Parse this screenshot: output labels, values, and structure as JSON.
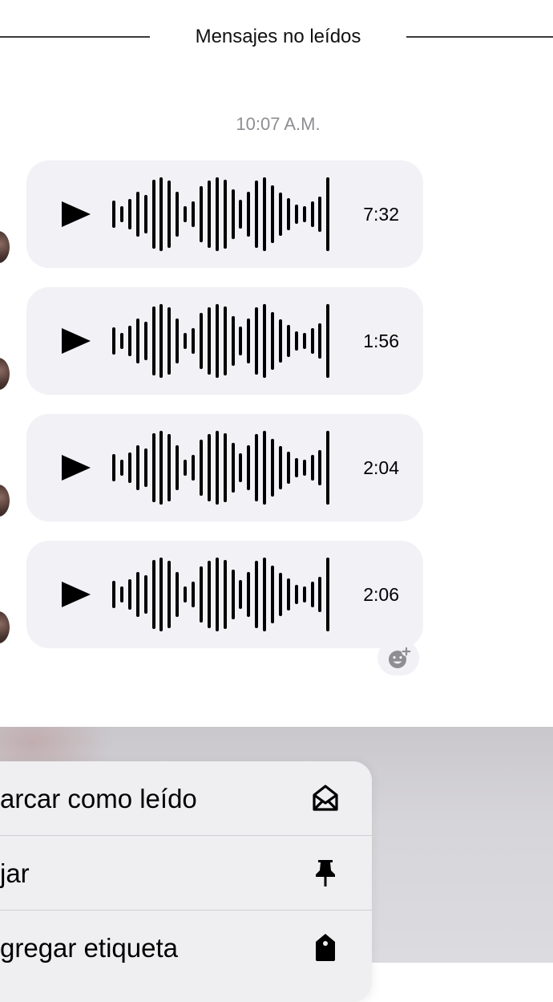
{
  "divider": {
    "label": "Mensajes no leídos"
  },
  "timestamp": "10:07 A.M.",
  "messages": [
    {
      "type": "voice",
      "duration": "7:32"
    },
    {
      "type": "voice",
      "duration": "1:56"
    },
    {
      "type": "voice",
      "duration": "2:04"
    },
    {
      "type": "voice",
      "duration": "2:06"
    }
  ],
  "icons": {
    "play": "play-icon",
    "add_reaction": "add-reaction-icon",
    "mark_read": "envelope-open-icon",
    "pin": "pin-icon",
    "tag": "tag-icon"
  },
  "context_menu": {
    "items": [
      {
        "label": "arcar como leído",
        "icon": "envelope-open-icon"
      },
      {
        "label": "jar",
        "icon": "pin-icon"
      },
      {
        "label": "gregar etiqueta",
        "icon": "tag-icon"
      }
    ]
  },
  "colors": {
    "bubble": "#f1f1f6",
    "timestamp": "#8e8e93",
    "menu_bg": "#efeff1"
  }
}
